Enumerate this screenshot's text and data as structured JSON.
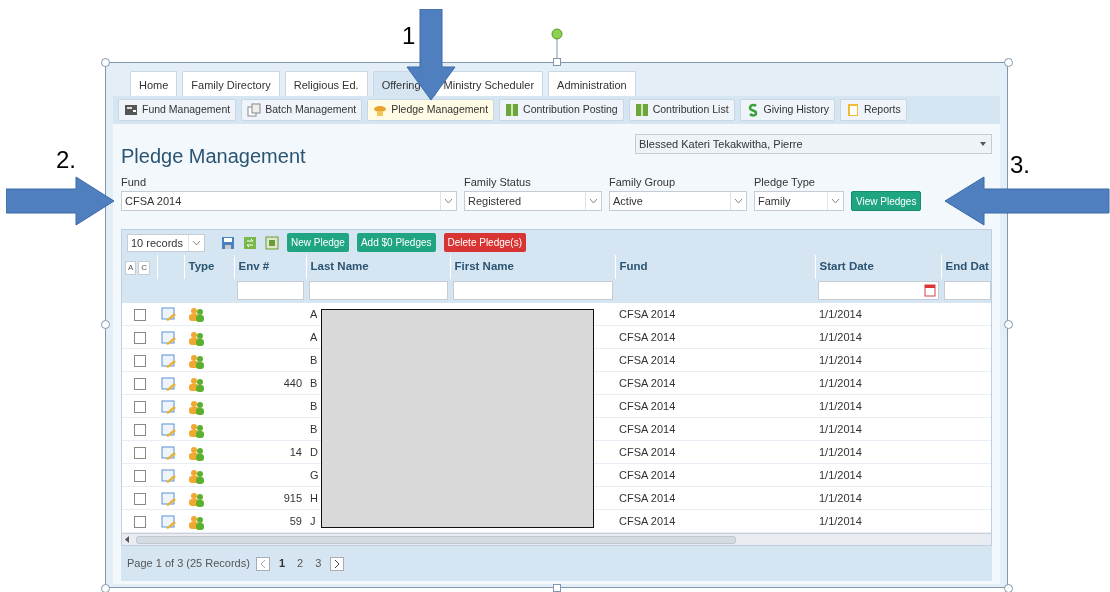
{
  "annotations": [
    {
      "label": "1"
    },
    {
      "label": "2."
    },
    {
      "label": "3."
    }
  ],
  "main_tabs": [
    {
      "label": "Home",
      "selected": false
    },
    {
      "label": "Family Directory",
      "selected": false
    },
    {
      "label": "Religious Ed.",
      "selected": false
    },
    {
      "label": "Offering",
      "selected": true
    },
    {
      "label": "Ministry Scheduler",
      "selected": false
    },
    {
      "label": "Administration",
      "selected": false
    }
  ],
  "sub_tabs": [
    {
      "label": "Fund Management",
      "selected": false
    },
    {
      "label": "Batch Management",
      "selected": false
    },
    {
      "label": "Pledge Management",
      "selected": true
    },
    {
      "label": "Contribution Posting",
      "selected": false
    },
    {
      "label": "Contribution List",
      "selected": false
    },
    {
      "label": "Giving History",
      "selected": false
    },
    {
      "label": "Reports",
      "selected": false
    }
  ],
  "page_title": "Pledge Management",
  "parish_select": {
    "value": "Blessed Kateri Tekakwitha, Pierre"
  },
  "filters": [
    {
      "label": "Fund",
      "value": "CFSA 2014"
    },
    {
      "label": "Family Status",
      "value": "Registered"
    },
    {
      "label": "Family Group",
      "value": "Active"
    },
    {
      "label": "Pledge Type",
      "value": "Family"
    }
  ],
  "view_button": "View Pledges",
  "toolbar": {
    "page_size": "10 records",
    "buttons": [
      {
        "label": "New Pledge",
        "kind": "primary"
      },
      {
        "label": "Add $0 Pledges",
        "kind": "primary"
      },
      {
        "label": "Delete Pledge(s)",
        "kind": "danger"
      }
    ]
  },
  "table": {
    "column_toggles": [
      "A",
      "C"
    ],
    "columns": [
      "Type",
      "Env #",
      "Last Name",
      "First Name",
      "Fund",
      "Start Date",
      "End Dat"
    ],
    "rows": [
      {
        "checked": false,
        "env": "",
        "last_name": "A",
        "fund": "CFSA 2014",
        "start_date": "1/1/2014"
      },
      {
        "checked": false,
        "env": "",
        "last_name": "A",
        "fund": "CFSA 2014",
        "start_date": "1/1/2014"
      },
      {
        "checked": false,
        "env": "",
        "last_name": "B",
        "fund": "CFSA 2014",
        "start_date": "1/1/2014"
      },
      {
        "checked": false,
        "env": "440",
        "last_name": "B",
        "fund": "CFSA 2014",
        "start_date": "1/1/2014"
      },
      {
        "checked": false,
        "env": "",
        "last_name": "B",
        "fund": "CFSA 2014",
        "start_date": "1/1/2014"
      },
      {
        "checked": false,
        "env": "",
        "last_name": "B",
        "fund": "CFSA 2014",
        "start_date": "1/1/2014"
      },
      {
        "checked": false,
        "env": "14",
        "last_name": "D",
        "fund": "CFSA 2014",
        "start_date": "1/1/2014"
      },
      {
        "checked": false,
        "env": "",
        "last_name": "G",
        "fund": "CFSA 2014",
        "start_date": "1/1/2014"
      },
      {
        "checked": false,
        "env": "915",
        "last_name": "H",
        "fund": "CFSA 2014",
        "start_date": "1/1/2014"
      },
      {
        "checked": false,
        "env": "59",
        "last_name": "J",
        "fund": "CFSA 2014",
        "start_date": "1/1/2014"
      }
    ]
  },
  "pager": {
    "summary": "Page 1 of 3 (25 Records)",
    "pages": [
      {
        "label": "1",
        "selected": true
      },
      {
        "label": "2",
        "selected": false
      },
      {
        "label": "3",
        "selected": false
      }
    ]
  }
}
